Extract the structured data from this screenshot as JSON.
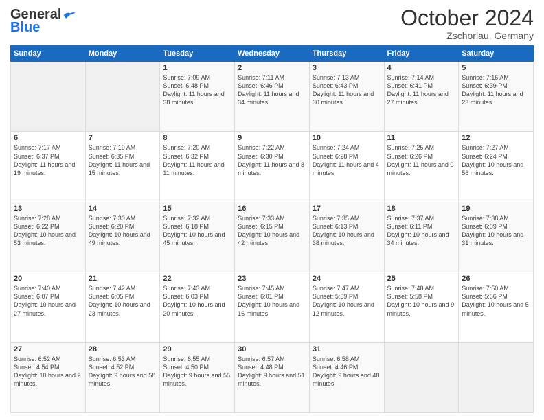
{
  "header": {
    "logo_line1": "General",
    "logo_line2": "Blue",
    "month": "October 2024",
    "location": "Zschorlau, Germany"
  },
  "weekdays": [
    "Sunday",
    "Monday",
    "Tuesday",
    "Wednesday",
    "Thursday",
    "Friday",
    "Saturday"
  ],
  "weeks": [
    [
      {
        "day": "",
        "detail": ""
      },
      {
        "day": "",
        "detail": ""
      },
      {
        "day": "1",
        "detail": "Sunrise: 7:09 AM\nSunset: 6:48 PM\nDaylight: 11 hours and 38 minutes."
      },
      {
        "day": "2",
        "detail": "Sunrise: 7:11 AM\nSunset: 6:46 PM\nDaylight: 11 hours and 34 minutes."
      },
      {
        "day": "3",
        "detail": "Sunrise: 7:13 AM\nSunset: 6:43 PM\nDaylight: 11 hours and 30 minutes."
      },
      {
        "day": "4",
        "detail": "Sunrise: 7:14 AM\nSunset: 6:41 PM\nDaylight: 11 hours and 27 minutes."
      },
      {
        "day": "5",
        "detail": "Sunrise: 7:16 AM\nSunset: 6:39 PM\nDaylight: 11 hours and 23 minutes."
      }
    ],
    [
      {
        "day": "6",
        "detail": "Sunrise: 7:17 AM\nSunset: 6:37 PM\nDaylight: 11 hours and 19 minutes."
      },
      {
        "day": "7",
        "detail": "Sunrise: 7:19 AM\nSunset: 6:35 PM\nDaylight: 11 hours and 15 minutes."
      },
      {
        "day": "8",
        "detail": "Sunrise: 7:20 AM\nSunset: 6:32 PM\nDaylight: 11 hours and 11 minutes."
      },
      {
        "day": "9",
        "detail": "Sunrise: 7:22 AM\nSunset: 6:30 PM\nDaylight: 11 hours and 8 minutes."
      },
      {
        "day": "10",
        "detail": "Sunrise: 7:24 AM\nSunset: 6:28 PM\nDaylight: 11 hours and 4 minutes."
      },
      {
        "day": "11",
        "detail": "Sunrise: 7:25 AM\nSunset: 6:26 PM\nDaylight: 11 hours and 0 minutes."
      },
      {
        "day": "12",
        "detail": "Sunrise: 7:27 AM\nSunset: 6:24 PM\nDaylight: 10 hours and 56 minutes."
      }
    ],
    [
      {
        "day": "13",
        "detail": "Sunrise: 7:28 AM\nSunset: 6:22 PM\nDaylight: 10 hours and 53 minutes."
      },
      {
        "day": "14",
        "detail": "Sunrise: 7:30 AM\nSunset: 6:20 PM\nDaylight: 10 hours and 49 minutes."
      },
      {
        "day": "15",
        "detail": "Sunrise: 7:32 AM\nSunset: 6:18 PM\nDaylight: 10 hours and 45 minutes."
      },
      {
        "day": "16",
        "detail": "Sunrise: 7:33 AM\nSunset: 6:15 PM\nDaylight: 10 hours and 42 minutes."
      },
      {
        "day": "17",
        "detail": "Sunrise: 7:35 AM\nSunset: 6:13 PM\nDaylight: 10 hours and 38 minutes."
      },
      {
        "day": "18",
        "detail": "Sunrise: 7:37 AM\nSunset: 6:11 PM\nDaylight: 10 hours and 34 minutes."
      },
      {
        "day": "19",
        "detail": "Sunrise: 7:38 AM\nSunset: 6:09 PM\nDaylight: 10 hours and 31 minutes."
      }
    ],
    [
      {
        "day": "20",
        "detail": "Sunrise: 7:40 AM\nSunset: 6:07 PM\nDaylight: 10 hours and 27 minutes."
      },
      {
        "day": "21",
        "detail": "Sunrise: 7:42 AM\nSunset: 6:05 PM\nDaylight: 10 hours and 23 minutes."
      },
      {
        "day": "22",
        "detail": "Sunrise: 7:43 AM\nSunset: 6:03 PM\nDaylight: 10 hours and 20 minutes."
      },
      {
        "day": "23",
        "detail": "Sunrise: 7:45 AM\nSunset: 6:01 PM\nDaylight: 10 hours and 16 minutes."
      },
      {
        "day": "24",
        "detail": "Sunrise: 7:47 AM\nSunset: 5:59 PM\nDaylight: 10 hours and 12 minutes."
      },
      {
        "day": "25",
        "detail": "Sunrise: 7:48 AM\nSunset: 5:58 PM\nDaylight: 10 hours and 9 minutes."
      },
      {
        "day": "26",
        "detail": "Sunrise: 7:50 AM\nSunset: 5:56 PM\nDaylight: 10 hours and 5 minutes."
      }
    ],
    [
      {
        "day": "27",
        "detail": "Sunrise: 6:52 AM\nSunset: 4:54 PM\nDaylight: 10 hours and 2 minutes."
      },
      {
        "day": "28",
        "detail": "Sunrise: 6:53 AM\nSunset: 4:52 PM\nDaylight: 9 hours and 58 minutes."
      },
      {
        "day": "29",
        "detail": "Sunrise: 6:55 AM\nSunset: 4:50 PM\nDaylight: 9 hours and 55 minutes."
      },
      {
        "day": "30",
        "detail": "Sunrise: 6:57 AM\nSunset: 4:48 PM\nDaylight: 9 hours and 51 minutes."
      },
      {
        "day": "31",
        "detail": "Sunrise: 6:58 AM\nSunset: 4:46 PM\nDaylight: 9 hours and 48 minutes."
      },
      {
        "day": "",
        "detail": ""
      },
      {
        "day": "",
        "detail": ""
      }
    ]
  ]
}
